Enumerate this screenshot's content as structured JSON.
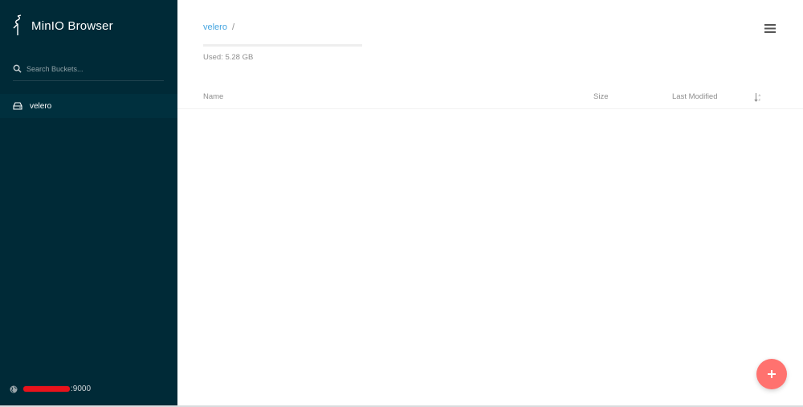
{
  "app": {
    "title": "MinIO Browser"
  },
  "sidebar": {
    "search_placeholder": "Search Buckets...",
    "buckets": [
      {
        "label": "velero",
        "active": true
      }
    ],
    "host": {
      "port_suffix": ":9000"
    }
  },
  "main": {
    "breadcrumb": {
      "bucket": "velero",
      "separator": "/"
    },
    "usage": {
      "label": "Used: 5.28 GB"
    },
    "table": {
      "columns": {
        "name": "Name",
        "size": "Size",
        "last_modified": "Last Modified"
      }
    }
  },
  "icons": {
    "logo": "minio-logo-icon",
    "search": "search-icon",
    "bucket": "drive-icon",
    "host": "globe-icon",
    "menu": "hamburger-menu-icon",
    "sort": "sort-icon",
    "fab": "plus-icon"
  },
  "colors": {
    "sidebar_bg": "#002a37",
    "active_bucket_bg": "#00303e",
    "link": "#46a5e0",
    "fab": "#ff726f"
  }
}
